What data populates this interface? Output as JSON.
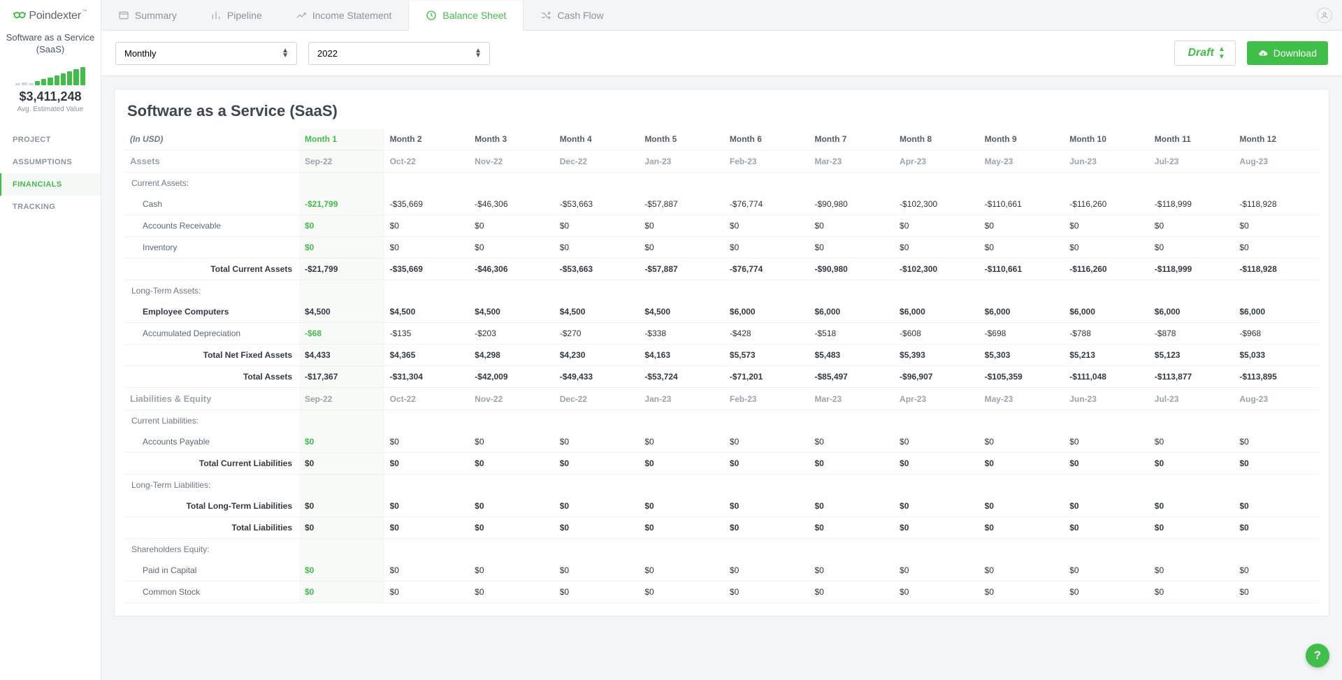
{
  "brand": "Poindexter",
  "sidebar": {
    "project_title": "Software as a Service (SaaS)",
    "kpi_value": "$3,411,248",
    "kpi_label": "Avg. Estimated Value",
    "nav": [
      "PROJECT",
      "ASSUMPTIONS",
      "FINANCIALS",
      "TRACKING"
    ],
    "active_nav": 2
  },
  "tabs": {
    "items": [
      "Summary",
      "Pipeline",
      "Income Statement",
      "Balance Sheet",
      "Cash Flow"
    ],
    "active": 3
  },
  "toolbar": {
    "period": "Monthly",
    "year": "2022",
    "status": "Draft",
    "download": "Download"
  },
  "panel_title": "Software as a Service (SaaS)",
  "currency_note": "(In USD)",
  "months": [
    "Month 1",
    "Month 2",
    "Month 3",
    "Month 4",
    "Month 5",
    "Month 6",
    "Month 7",
    "Month 8",
    "Month 9",
    "Month 10",
    "Month 11",
    "Month 12"
  ],
  "dates": [
    "Sep-22",
    "Oct-22",
    "Nov-22",
    "Dec-22",
    "Jan-23",
    "Feb-23",
    "Mar-23",
    "Apr-23",
    "May-23",
    "Jun-23",
    "Jul-23",
    "Aug-23"
  ],
  "sections": {
    "assets_label": "Assets",
    "liab_label": "Liabilities & Equity"
  },
  "rows": {
    "current_assets_lbl": "Current Assets:",
    "cash": {
      "lbl": "Cash",
      "v": [
        "-$21,799",
        "-$35,669",
        "-$46,306",
        "-$53,663",
        "-$57,887",
        "-$76,774",
        "-$90,980",
        "-$102,300",
        "-$110,661",
        "-$116,260",
        "-$118,999",
        "-$118,928"
      ]
    },
    "ar": {
      "lbl": "Accounts Receivable",
      "v": [
        "$0",
        "$0",
        "$0",
        "$0",
        "$0",
        "$0",
        "$0",
        "$0",
        "$0",
        "$0",
        "$0",
        "$0"
      ]
    },
    "inv": {
      "lbl": "Inventory",
      "v": [
        "$0",
        "$0",
        "$0",
        "$0",
        "$0",
        "$0",
        "$0",
        "$0",
        "$0",
        "$0",
        "$0",
        "$0"
      ]
    },
    "tca": {
      "lbl": "Total Current Assets",
      "v": [
        "-$21,799",
        "-$35,669",
        "-$46,306",
        "-$53,663",
        "-$57,887",
        "-$76,774",
        "-$90,980",
        "-$102,300",
        "-$110,661",
        "-$116,260",
        "-$118,999",
        "-$118,928"
      ]
    },
    "lta_lbl": "Long-Term Assets:",
    "emp": {
      "lbl": "Employee Computers",
      "v": [
        "$4,500",
        "$4,500",
        "$4,500",
        "$4,500",
        "$4,500",
        "$6,000",
        "$6,000",
        "$6,000",
        "$6,000",
        "$6,000",
        "$6,000",
        "$6,000"
      ]
    },
    "dep": {
      "lbl": "Accumulated Depreciation",
      "v": [
        "-$68",
        "-$135",
        "-$203",
        "-$270",
        "-$338",
        "-$428",
        "-$518",
        "-$608",
        "-$698",
        "-$788",
        "-$878",
        "-$968"
      ]
    },
    "tnfa": {
      "lbl": "Total Net Fixed Assets",
      "v": [
        "$4,433",
        "$4,365",
        "$4,298",
        "$4,230",
        "$4,163",
        "$5,573",
        "$5,483",
        "$5,393",
        "$5,303",
        "$5,213",
        "$5,123",
        "$5,033"
      ]
    },
    "ta": {
      "lbl": "Total Assets",
      "v": [
        "-$17,367",
        "-$31,304",
        "-$42,009",
        "-$49,433",
        "-$53,724",
        "-$71,201",
        "-$85,497",
        "-$96,907",
        "-$105,359",
        "-$111,048",
        "-$113,877",
        "-$113,895"
      ]
    },
    "cl_lbl": "Current Liabilities:",
    "ap": {
      "lbl": "Accounts Payable",
      "v": [
        "$0",
        "$0",
        "$0",
        "$0",
        "$0",
        "$0",
        "$0",
        "$0",
        "$0",
        "$0",
        "$0",
        "$0"
      ]
    },
    "tcl": {
      "lbl": "Total Current Liabilities",
      "v": [
        "$0",
        "$0",
        "$0",
        "$0",
        "$0",
        "$0",
        "$0",
        "$0",
        "$0",
        "$0",
        "$0",
        "$0"
      ]
    },
    "ltl_lbl": "Long-Term Liabilities:",
    "tltl": {
      "lbl": "Total Long-Term Liabilities",
      "v": [
        "$0",
        "$0",
        "$0",
        "$0",
        "$0",
        "$0",
        "$0",
        "$0",
        "$0",
        "$0",
        "$0",
        "$0"
      ]
    },
    "tl": {
      "lbl": "Total Liabilities",
      "v": [
        "$0",
        "$0",
        "$0",
        "$0",
        "$0",
        "$0",
        "$0",
        "$0",
        "$0",
        "$0",
        "$0",
        "$0"
      ]
    },
    "se_lbl": "Shareholders Equity:",
    "pic": {
      "lbl": "Paid in Capital",
      "v": [
        "$0",
        "$0",
        "$0",
        "$0",
        "$0",
        "$0",
        "$0",
        "$0",
        "$0",
        "$0",
        "$0",
        "$0"
      ]
    },
    "cs": {
      "lbl": "Common Stock",
      "v": [
        "$0",
        "$0",
        "$0",
        "$0",
        "$0",
        "$0",
        "$0",
        "$0",
        "$0",
        "$0",
        "$0",
        "$0"
      ]
    }
  }
}
